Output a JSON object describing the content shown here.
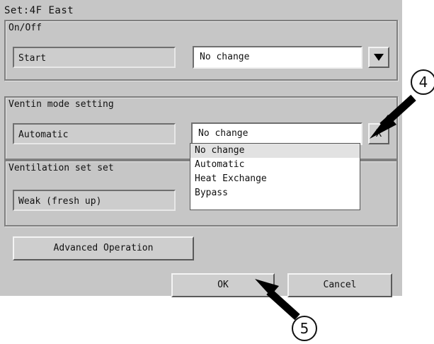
{
  "title": "Set:4F East",
  "groups": {
    "onoff": {
      "label": "On/Off",
      "current": "Start",
      "select_value": "No change"
    },
    "ventin": {
      "label": "Ventin mode setting",
      "current": "Automatic",
      "select_value": "No change",
      "close_glyph": "X"
    },
    "ventset": {
      "label": "Ventilation set set",
      "current": "Weak (fresh up)"
    }
  },
  "dropdown_options": [
    "No change",
    "Automatic",
    "Heat Exchange",
    "Bypass"
  ],
  "dropdown_selected": "No change",
  "buttons": {
    "advanced": "Advanced Operation",
    "ok": "OK",
    "cancel": "Cancel"
  },
  "callouts": {
    "four": "4",
    "five": "5"
  },
  "colors": {
    "dialog_bg": "#c6c6c6",
    "field_bg": "#ffffff",
    "arrow": "#000000"
  },
  "icons": {
    "dropdown_arrow": "triangle-down-icon"
  }
}
